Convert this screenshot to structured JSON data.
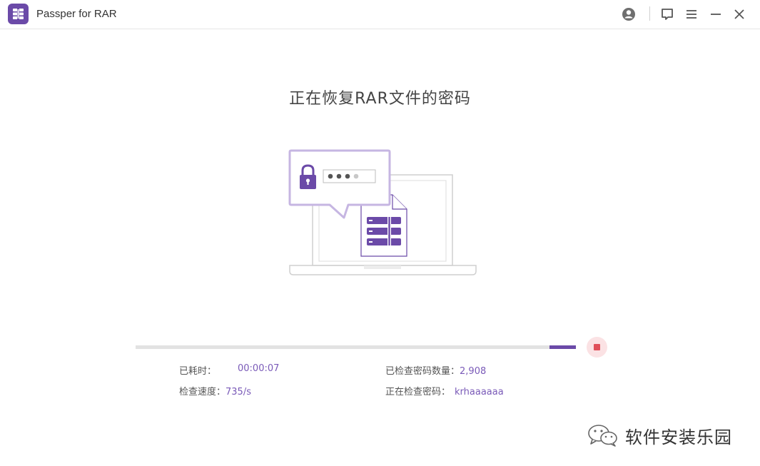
{
  "app": {
    "title": "Passper for RAR",
    "logo_icon": "rar-archive-logo-icon",
    "brand_color": "#6b4aa8"
  },
  "titlebar": {
    "icons": [
      "account-icon",
      "feedback-icon",
      "menu-icon",
      "minimize-icon",
      "close-icon"
    ]
  },
  "main": {
    "heading": "正在恢复RAR文件的密码",
    "illustration_icon": "laptop-lock-archive-icon"
  },
  "progress": {
    "fraction": 0.94,
    "stop_icon": "stop-icon",
    "stop_color": "#e0505a"
  },
  "stats": {
    "elapsed_label": "已耗时：",
    "elapsed_value": "00:00:07",
    "speed_label": "检查速度：",
    "speed_value": "735/s",
    "checked_label": "已检查密码数量：",
    "checked_value": "2,908",
    "current_label": "正在检查密码：",
    "current_value": "krhaaaaaa"
  },
  "watermark": {
    "text": "软件安装乐园",
    "icon": "wechat-icon"
  }
}
